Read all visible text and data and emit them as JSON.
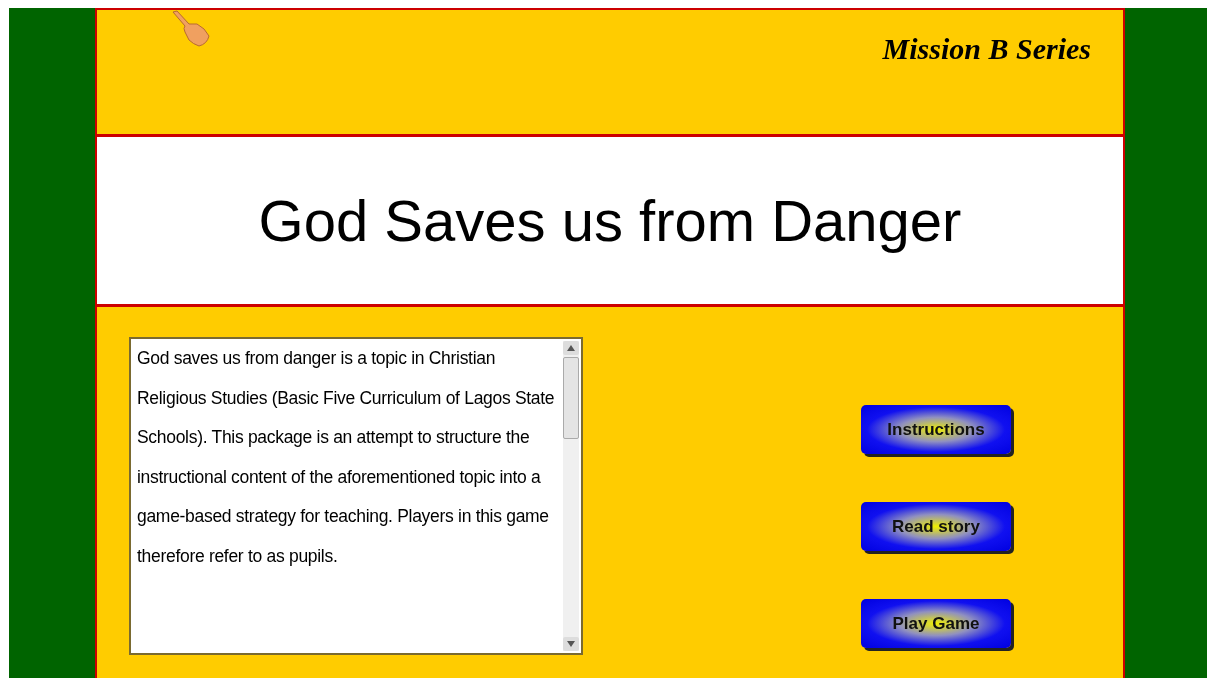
{
  "header": {
    "series": "Mission B Series"
  },
  "title": "God Saves us from Danger",
  "description": {
    "text": "God saves us from danger is a topic in Christian Religious Studies (Basic Five Curriculum of Lagos State Schools). This package is an attempt to structure the instructional content of the aforementioned topic into a game-based strategy for teaching. Players in this game therefore refer to as pupils."
  },
  "buttons": [
    "Instructions",
    "Read story",
    "Play Game"
  ]
}
